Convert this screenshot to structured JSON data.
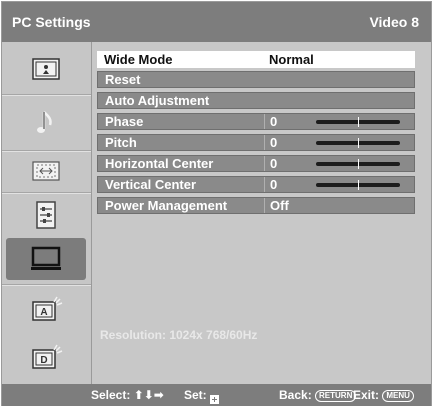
{
  "header": {
    "title": "PC Settings",
    "input": "Video 8"
  },
  "sidebar": {
    "items": [
      {
        "name": "picture",
        "icon": "picture-icon"
      },
      {
        "name": "sound",
        "icon": "music-note-icon"
      },
      {
        "name": "screen",
        "icon": "screen-adjust-icon"
      },
      {
        "name": "setup",
        "icon": "setup-icon"
      },
      {
        "name": "pc-settings",
        "icon": "monitor-icon",
        "active": true
      },
      {
        "name": "analog-setup",
        "icon": "analog-setup-icon",
        "label": "A"
      },
      {
        "name": "digital-setup",
        "icon": "digital-setup-icon",
        "label": "D"
      }
    ]
  },
  "menu": {
    "rows": [
      {
        "label": "Wide Mode",
        "value": "Normal"
      },
      {
        "label": "Reset",
        "value": ""
      },
      {
        "label": "Auto Adjustment",
        "value": ""
      },
      {
        "label": "Phase",
        "value": "0",
        "slider": 0.5
      },
      {
        "label": "Pitch",
        "value": "0",
        "slider": 0.5
      },
      {
        "label": "Horizontal Center",
        "value": "0",
        "slider": 0.5
      },
      {
        "label": "Vertical Center",
        "value": "0",
        "slider": 0.5
      },
      {
        "label": "Power Management",
        "value": "Off"
      }
    ],
    "resolution": "Resolution: 1024x 768/60Hz"
  },
  "footer": {
    "select_label": "Select: ",
    "arrows": "⬆⬇➡",
    "set_label": "Set: ",
    "back_label": "Back: ",
    "return_key": "RETURN",
    "exit_label": "Exit: ",
    "menu_key": "MENU"
  }
}
